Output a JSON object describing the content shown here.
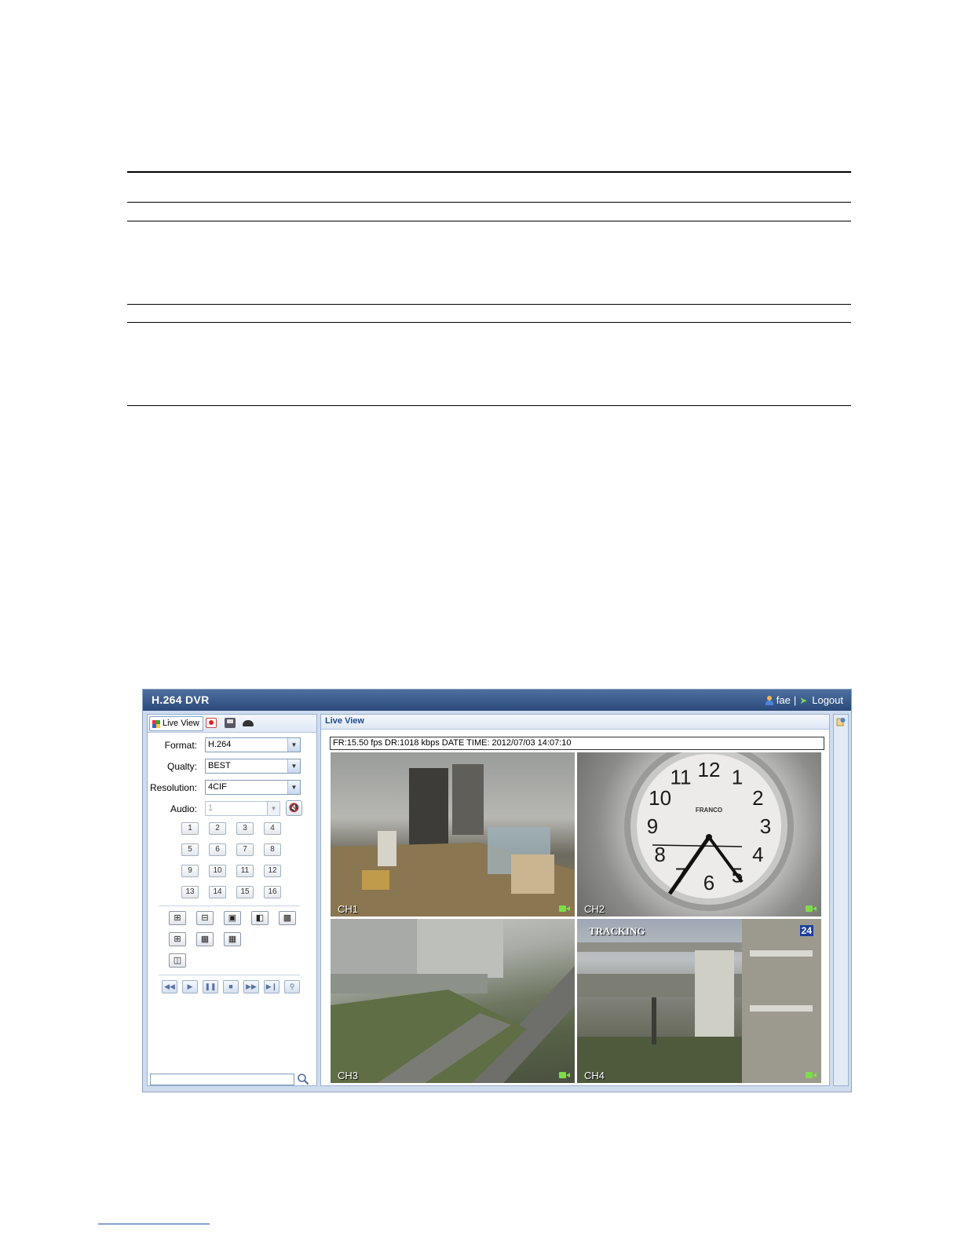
{
  "window": {
    "title": "H.264 DVR",
    "user_name": "fae",
    "separator": "|",
    "logout_label": "Logout"
  },
  "left_panel": {
    "tabs": [
      {
        "label": "Live View",
        "icon": "quad-view-icon"
      },
      {
        "label": "",
        "icon": "record-icon"
      },
      {
        "label": "",
        "icon": "network-icon"
      },
      {
        "label": "",
        "icon": "dome-camera-icon"
      }
    ],
    "format": {
      "label": "Format:",
      "value": "H.264"
    },
    "quality": {
      "label": "Qualty:",
      "value": "BEST"
    },
    "resolution": {
      "label": "Resolution:",
      "value": "4CIF"
    },
    "audio": {
      "label": "Audio:",
      "value": "1"
    },
    "channels": [
      "1",
      "2",
      "3",
      "4",
      "5",
      "6",
      "7",
      "8",
      "9",
      "10",
      "11",
      "12",
      "13",
      "14",
      "15",
      "16"
    ],
    "tools": [
      "zoom-in-icon",
      "zoom-out-icon",
      "snapshot-icon",
      "pip-icon",
      "pop-icon",
      "quad-layout-icon",
      "nine-layout-icon",
      "sixteen-layout-icon",
      "sequence-icon"
    ],
    "playback": [
      "rewind-icon",
      "play-icon",
      "pause-icon",
      "stop-icon",
      "fast-forward-icon",
      "next-icon",
      "search-icon"
    ]
  },
  "main_panel": {
    "title": "Live View",
    "status": "FR:15.50 fps  DR:1018 kbps  DATE TIME: 2012/07/03 14:07:10",
    "cameras": [
      {
        "label": "CH1"
      },
      {
        "label": "CH2",
        "clock_brand": "FRANCO",
        "clock_numbers": [
          "12",
          "1",
          "2",
          "3",
          "4",
          "5",
          "6",
          "7",
          "8",
          "9",
          "10",
          "11"
        ]
      },
      {
        "label": "CH3"
      },
      {
        "label": "CH4",
        "overlay_text": "TRACKING",
        "overlay_number": "24"
      }
    ]
  },
  "colors": {
    "titlebar": "#3a5a8c",
    "panel_border": "#99b0d2",
    "record_indicator": "#7edc4a"
  }
}
